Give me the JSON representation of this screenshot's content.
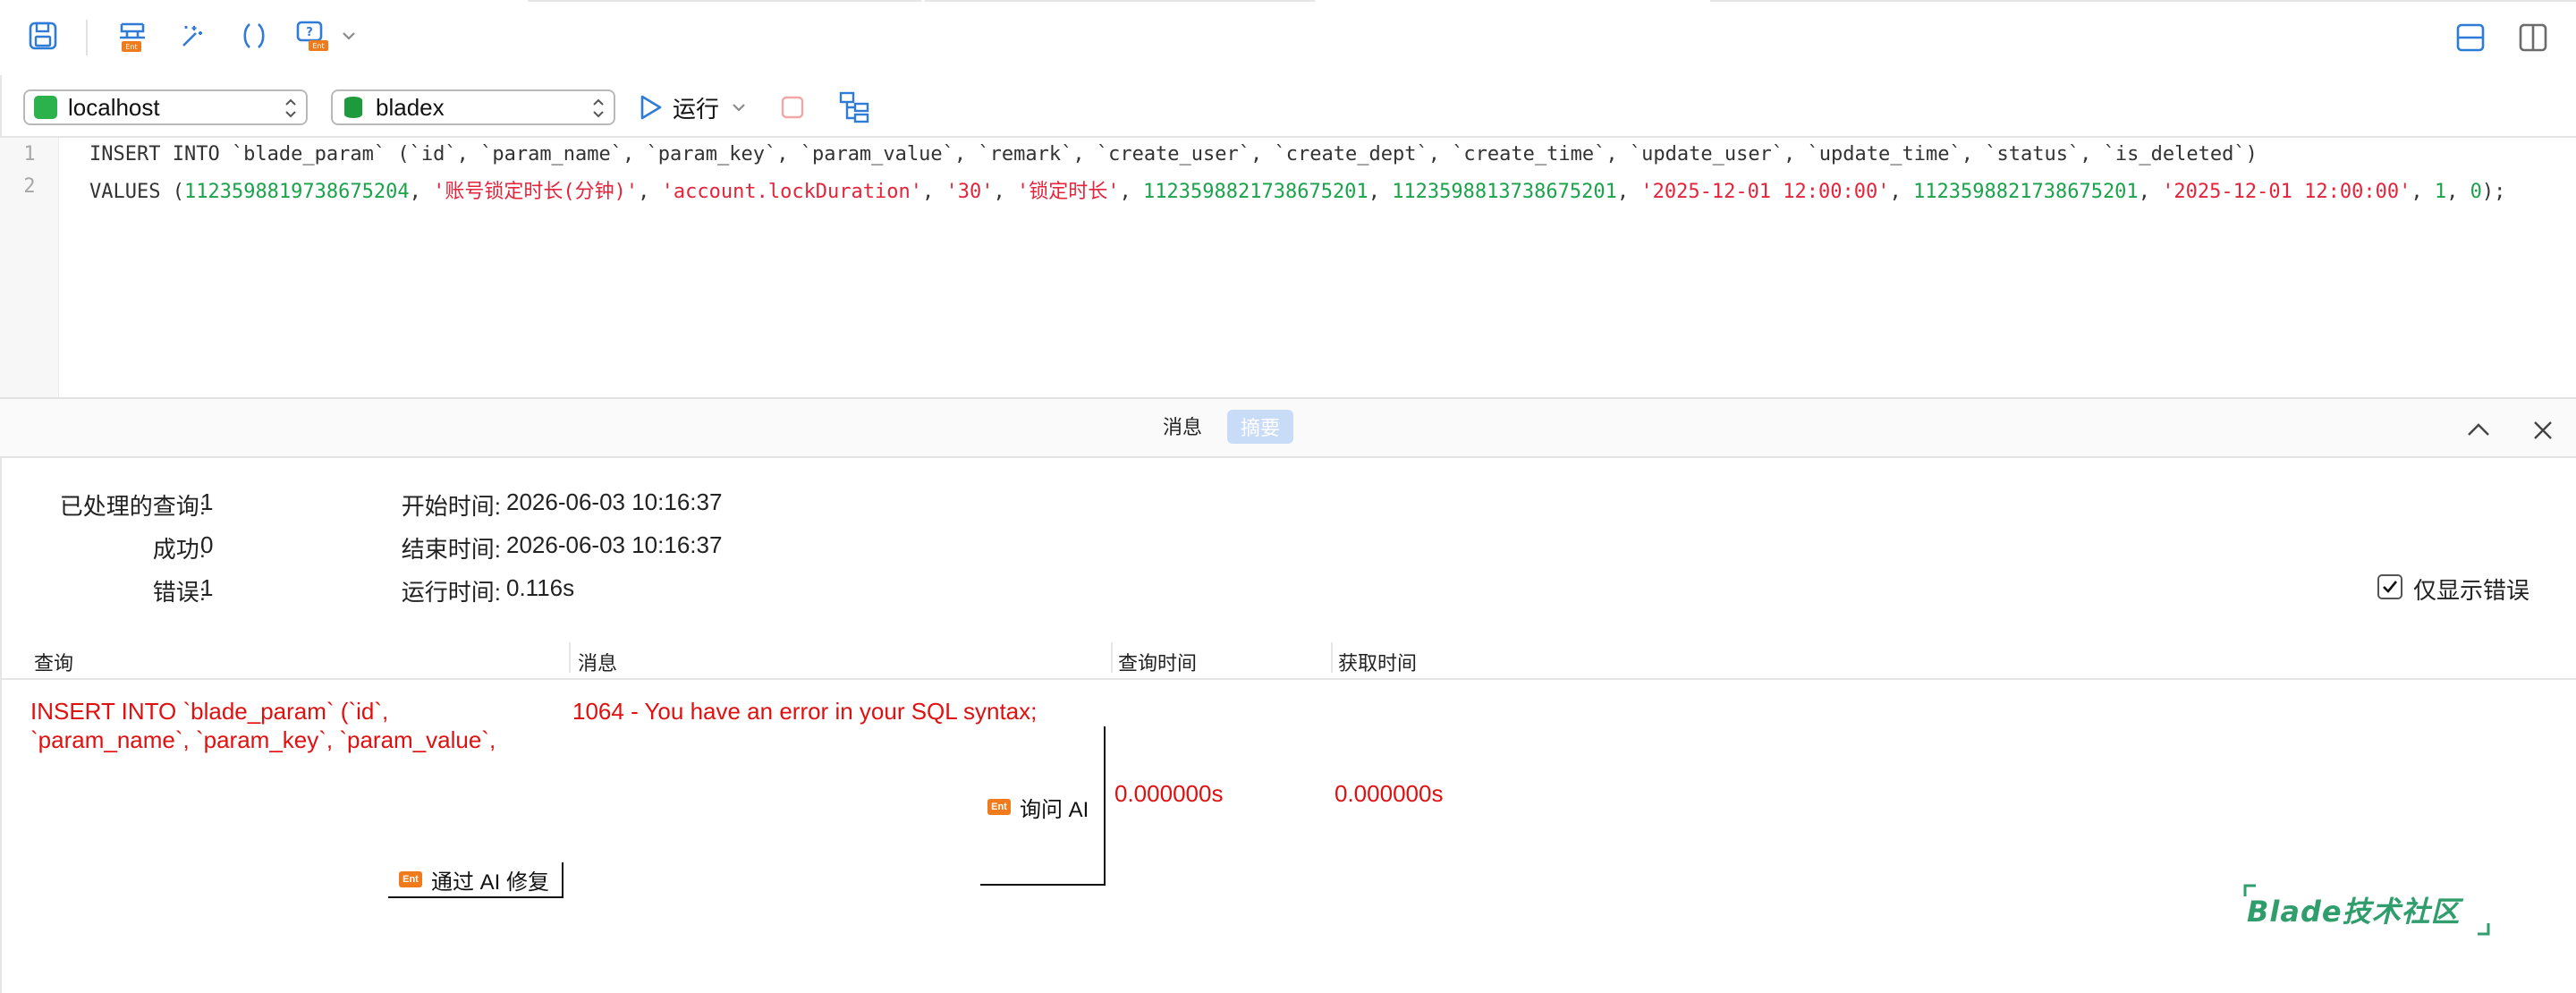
{
  "toolbar": {
    "save_icon": "save-icon",
    "explain_icon": "explain-icon",
    "beautify_icon": "magic-wand-icon",
    "brackets_icon": "brackets-icon",
    "code_snippet_icon": "code-snippet-icon",
    "layout_horizontal_icon": "layout-horizontal-icon",
    "layout_vertical_icon": "layout-vertical-icon"
  },
  "connection": {
    "host": "localhost",
    "database": "bladex",
    "run_label": "运行"
  },
  "editor": {
    "line_numbers": [
      "1",
      "2"
    ],
    "line1": "INSERT INTO `blade_param` (`id`, `param_name`, `param_key`, `param_value`, `remark`, `create_user`, `create_dept`, `create_time`, `update_user`, `update_time`, `status`, `is_deleted`)",
    "line2": {
      "prefix": "VALUES (",
      "id": "1123598819738675204",
      "param_name": "'账号锁定时长(分钟)'",
      "param_key": "'account.lockDuration'",
      "param_value": "'30'",
      "remark": "'锁定时长'",
      "create_user": "1123598821738675201",
      "create_dept": "1123598813738675201",
      "create_time": "'2025-12-01 12:00:00'",
      "update_user": "1123598821738675201",
      "update_time": "'2025-12-01 12:00:00'",
      "status": "1",
      "is_deleted": "0",
      "sep": ", ",
      "suffix": ");"
    }
  },
  "result_tabs": {
    "message": "消息",
    "summary": "摘要"
  },
  "summary": {
    "processed_label": "已处理的查询:",
    "processed_value": "1",
    "success_label": "成功:",
    "success_value": "0",
    "error_label": "错误:",
    "error_value": "1",
    "start_label": "开始时间:",
    "start_value": "2026-06-03 10:16:37",
    "end_label": "结束时间:",
    "end_value": "2026-06-03 10:16:37",
    "elapsed_label": "运行时间:",
    "elapsed_value": "0.116s",
    "only_errors_label": "仅显示错误",
    "only_errors_checked": true
  },
  "table": {
    "headers": [
      "查询",
      "消息",
      "查询时间",
      "获取时间"
    ],
    "row": {
      "query_line1": "INSERT INTO `blade_param` (`id`,",
      "query_line2": "`param_name`, `param_key`, `param_value`,",
      "message": "1064 - You have an error in your SQL syntax;",
      "query_time": "0.000000s",
      "fetch_time": "0.000000s",
      "ask_ai_label": "询问 AI",
      "fix_ai_label": "通过 AI 修复",
      "ai_badge": "Ent"
    }
  },
  "watermark": {
    "text": "Blade技术社区"
  },
  "colors": {
    "error": "#e01010",
    "string": "#e4243b",
    "number": "#1aa34a",
    "accent": "#2f7bd8"
  }
}
